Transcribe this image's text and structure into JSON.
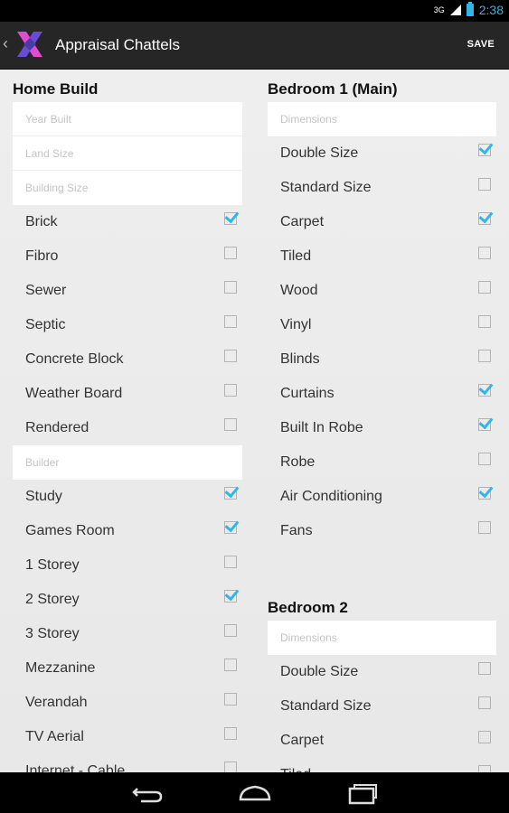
{
  "statusbar": {
    "network": "3G",
    "time": "2:38"
  },
  "actionbar": {
    "title": "Appraisal Chattels",
    "save_label": "SAVE"
  },
  "left": {
    "title": "Home Build",
    "inputs": [
      {
        "placeholder": "Year Built",
        "value": ""
      },
      {
        "placeholder": "Land Size",
        "value": ""
      },
      {
        "placeholder": "Building Size",
        "value": ""
      }
    ],
    "items": [
      {
        "label": "Brick",
        "checked": true
      },
      {
        "label": "Fibro",
        "checked": false
      },
      {
        "label": "Sewer",
        "checked": false
      },
      {
        "label": "Septic",
        "checked": false
      },
      {
        "label": "Concrete Block",
        "checked": false
      },
      {
        "label": "Weather Board",
        "checked": false
      },
      {
        "label": "Rendered",
        "checked": false
      }
    ],
    "builder_placeholder": "Builder",
    "items2": [
      {
        "label": "Study",
        "checked": true
      },
      {
        "label": "Games Room",
        "checked": true
      },
      {
        "label": "1 Storey",
        "checked": false
      },
      {
        "label": "2 Storey",
        "checked": true
      },
      {
        "label": "3 Storey",
        "checked": false
      },
      {
        "label": "Mezzanine",
        "checked": false
      },
      {
        "label": "Verandah",
        "checked": false
      },
      {
        "label": "TV Aerial",
        "checked": false
      },
      {
        "label": "Internet - Cable",
        "checked": false
      }
    ]
  },
  "right": {
    "bed1": {
      "title": "Bedroom 1 (Main)",
      "dimensions_placeholder": "Dimensions",
      "items": [
        {
          "label": "Double Size",
          "checked": true
        },
        {
          "label": "Standard Size",
          "checked": false
        },
        {
          "label": "Carpet",
          "checked": true
        },
        {
          "label": "Tiled",
          "checked": false
        },
        {
          "label": "Wood",
          "checked": false
        },
        {
          "label": "Vinyl",
          "checked": false
        },
        {
          "label": "Blinds",
          "checked": false
        },
        {
          "label": "Curtains",
          "checked": true
        },
        {
          "label": "Built In Robe",
          "checked": true
        },
        {
          "label": "Robe",
          "checked": false
        },
        {
          "label": "Air Conditioning",
          "checked": true
        },
        {
          "label": "Fans",
          "checked": false
        }
      ]
    },
    "bed2": {
      "title": "Bedroom 2",
      "dimensions_placeholder": "Dimensions",
      "items": [
        {
          "label": "Double Size",
          "checked": false
        },
        {
          "label": "Standard Size",
          "checked": false
        },
        {
          "label": "Carpet",
          "checked": false
        },
        {
          "label": "Tiled",
          "checked": false
        }
      ]
    }
  },
  "colors": {
    "accent": "#33b5e5",
    "actionbar": "#262626",
    "background": "#e9e9e9"
  },
  "icons": {
    "back": "chevron-left-icon",
    "logo": "app-logo-x",
    "nav": [
      "back-icon",
      "home-icon",
      "recent-apps-icon"
    ]
  }
}
